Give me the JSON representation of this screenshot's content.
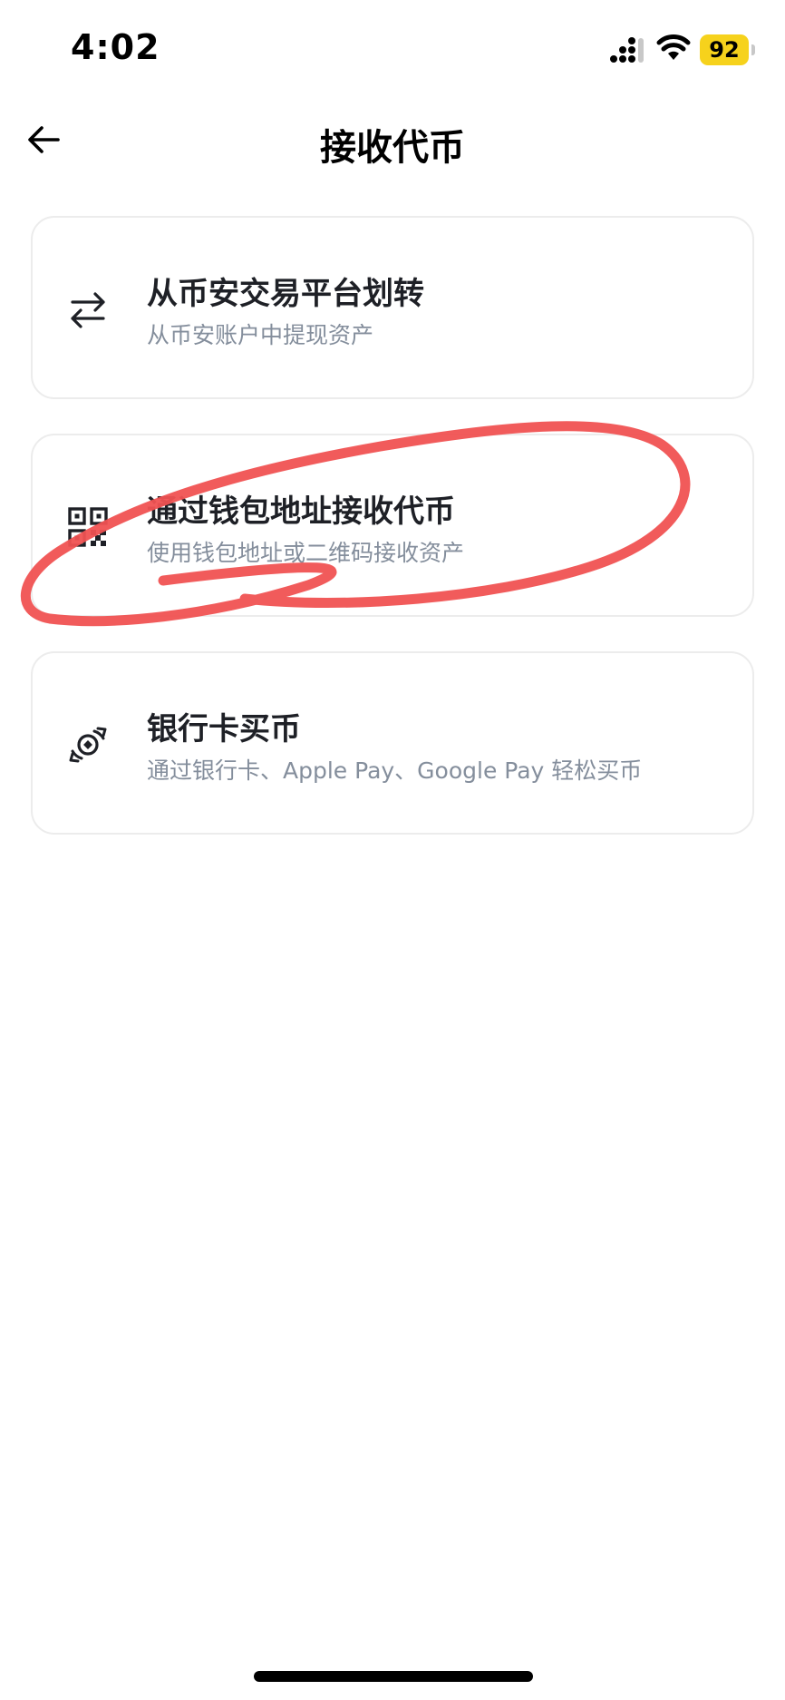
{
  "status_bar": {
    "time": "4:02",
    "battery": "92",
    "battery_color": "#f6d21c"
  },
  "header": {
    "title": "接收代币",
    "back_icon": "arrow-left-icon"
  },
  "options": [
    {
      "title": "从币安交易平台划转",
      "subtitle": "从币安账户中提现资产",
      "icon": "transfer-arrows-icon"
    },
    {
      "title": "通过钱包地址接收代币",
      "subtitle": "使用钱包地址或二维码接收资产",
      "icon": "qr-code-icon"
    },
    {
      "title": "银行卡买币",
      "subtitle": "通过银行卡、Apple Pay、Google Pay 轻松买币",
      "icon": "coin-exchange-icon"
    }
  ],
  "annotation": {
    "color": "#f05252",
    "circled_option": "通过钱包地址接收代币"
  },
  "colors": {
    "title_text": "#1e2026",
    "subtitle_text": "#848e9c",
    "card_border": "#ececec"
  }
}
